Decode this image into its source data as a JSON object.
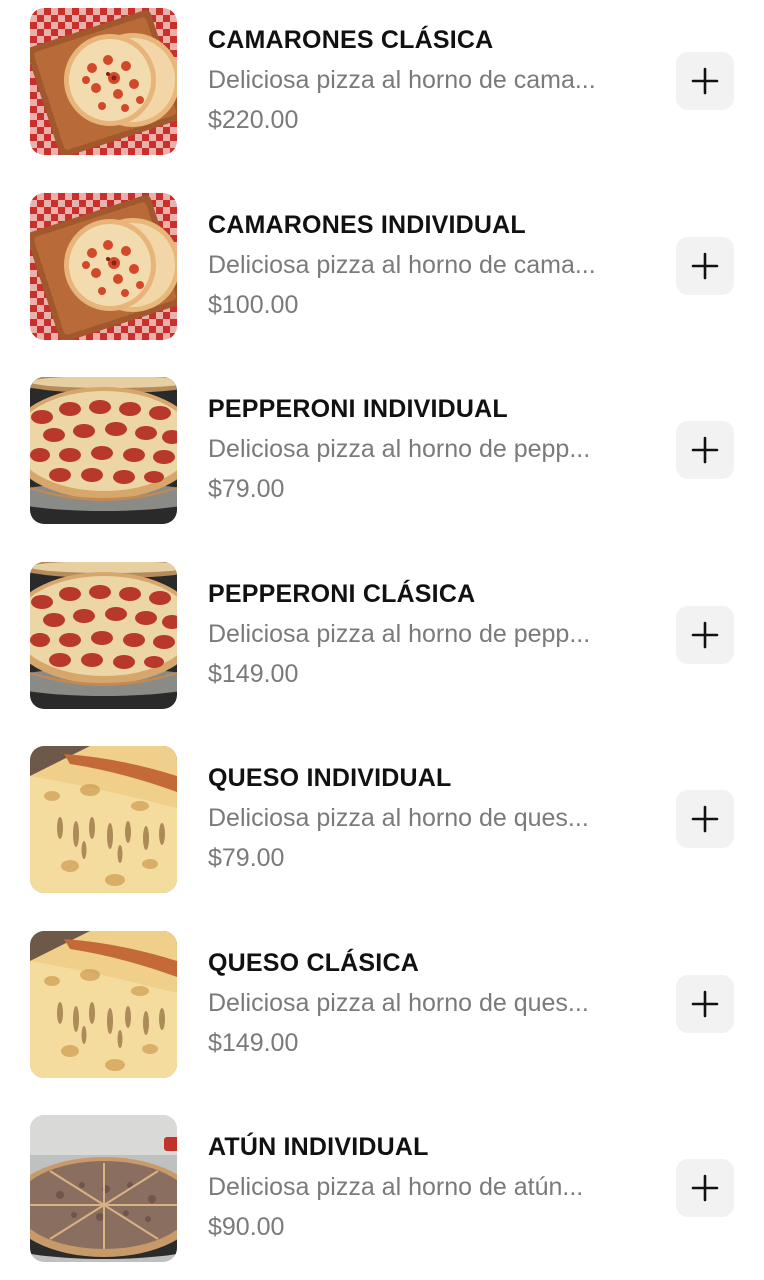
{
  "items": [
    {
      "name": "CAMARONES CLÁSICA",
      "description": "Deliciosa pizza al horno de cama...",
      "price": "$220.00",
      "image_icon": "shrimp-pizza-image"
    },
    {
      "name": "CAMARONES INDIVIDUAL",
      "description": "Deliciosa pizza al horno de cama...",
      "price": "$100.00",
      "image_icon": "shrimp-pizza-image"
    },
    {
      "name": "PEPPERONI INDIVIDUAL",
      "description": "Deliciosa pizza al horno de pepp...",
      "price": "$79.00",
      "image_icon": "pepperoni-pizza-image"
    },
    {
      "name": "PEPPERONI CLÁSICA",
      "description": "Deliciosa pizza al horno de pepp...",
      "price": "$149.00",
      "image_icon": "pepperoni-pizza-image"
    },
    {
      "name": "QUESO INDIVIDUAL",
      "description": "Deliciosa pizza al horno de ques...",
      "price": "$79.00",
      "image_icon": "cheese-pizza-image"
    },
    {
      "name": "QUESO CLÁSICA",
      "description": "Deliciosa pizza al horno de ques...",
      "price": "$149.00",
      "image_icon": "cheese-pizza-image"
    },
    {
      "name": "ATÚN INDIVIDUAL",
      "description": "Deliciosa pizza al horno de atún...",
      "price": "$90.00",
      "image_icon": "tuna-pizza-image"
    }
  ],
  "add_button_icon": "plus-icon",
  "colors": {
    "name_text": "#111111",
    "secondary_text": "#7a7a7a",
    "add_button_bg": "#f2f2f2"
  }
}
